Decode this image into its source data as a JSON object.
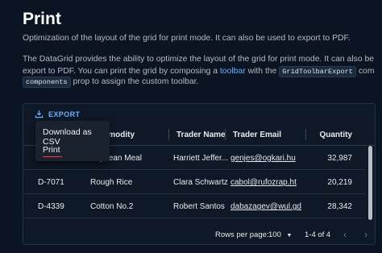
{
  "page": {
    "title": "Print",
    "para1": "Optimization of the layout of the grid for print mode. It can also be used to export to PDF.",
    "para2_line1": "The DataGrid provides the ability to optimize the layout of the grid for print mode. It can also be used to",
    "para2_line2_a": "export to PDF. You can print the grid by composing a",
    "para2_line2_link": "toolbar",
    "para2_line2_b": "with the",
    "para2_line2_code": "GridToolbarExport",
    "para2_line2_c": "component. Use the",
    "para2_line3_code": "components",
    "para2_line3_b": "prop to assign the custom toolbar."
  },
  "toolbar": {
    "export_label": "EXPORT",
    "icon": "download-icon"
  },
  "menu": {
    "items": [
      "Download as CSV",
      "Print"
    ]
  },
  "columns": {
    "commodity": "Commodity",
    "trader_name": "Trader Name",
    "trader_email": "Trader Email",
    "quantity": "Quantity"
  },
  "rows": [
    {
      "id": "",
      "commodity": "Soybean Meal",
      "trader": "Harriett Jeffer...",
      "email": "genjes@ogkari.hu",
      "quantity": "32,987"
    },
    {
      "id": "D-7071",
      "commodity": "Rough Rice",
      "trader": "Clara Schwartz",
      "email": "cabol@rufozrap.ht",
      "quantity": "20,219"
    },
    {
      "id": "D-4339",
      "commodity": "Cotton No.2",
      "trader": "Robert Santos",
      "email": "dabazagev@wul.gd",
      "quantity": "28,342"
    }
  ],
  "footer": {
    "rows_per_page_label": "Rows per page:",
    "rows_per_page_value": "100",
    "range": "1-4 of 4"
  },
  "colors": {
    "accent": "#66b2ff",
    "background": "#0b1423"
  }
}
